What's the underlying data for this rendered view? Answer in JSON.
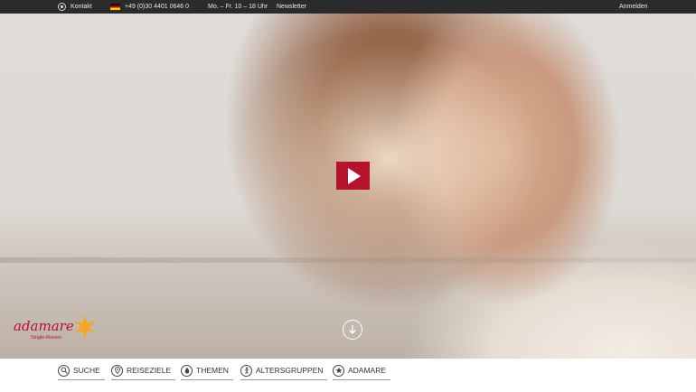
{
  "topbar": {
    "contact_label": "Kontakt",
    "phone": "+49 (0)30 4401 0646 0",
    "hours": "Mo. – Fr. 10 – 18 Uhr",
    "newsletter_label": "Newsletter",
    "login_label": "Anmelden"
  },
  "brand": {
    "logo_text": "adamare",
    "logo_subtext": "Single-Reisen",
    "accent_color": "#b5122e",
    "star_color": "#f5a623"
  },
  "hero": {
    "play_icon": "play-icon",
    "scroll_icon": "arrow-down-circle-icon"
  },
  "nav": {
    "items": [
      {
        "label": "SUCHE",
        "icon": "search-icon"
      },
      {
        "label": "REISEZIELE",
        "icon": "map-pin-icon"
      },
      {
        "label": "THEMEN",
        "icon": "drop-icon"
      },
      {
        "label": "ALTERSGRUPPEN",
        "icon": "person-icon"
      },
      {
        "label": "ADAMARE",
        "icon": "star-icon"
      }
    ]
  }
}
